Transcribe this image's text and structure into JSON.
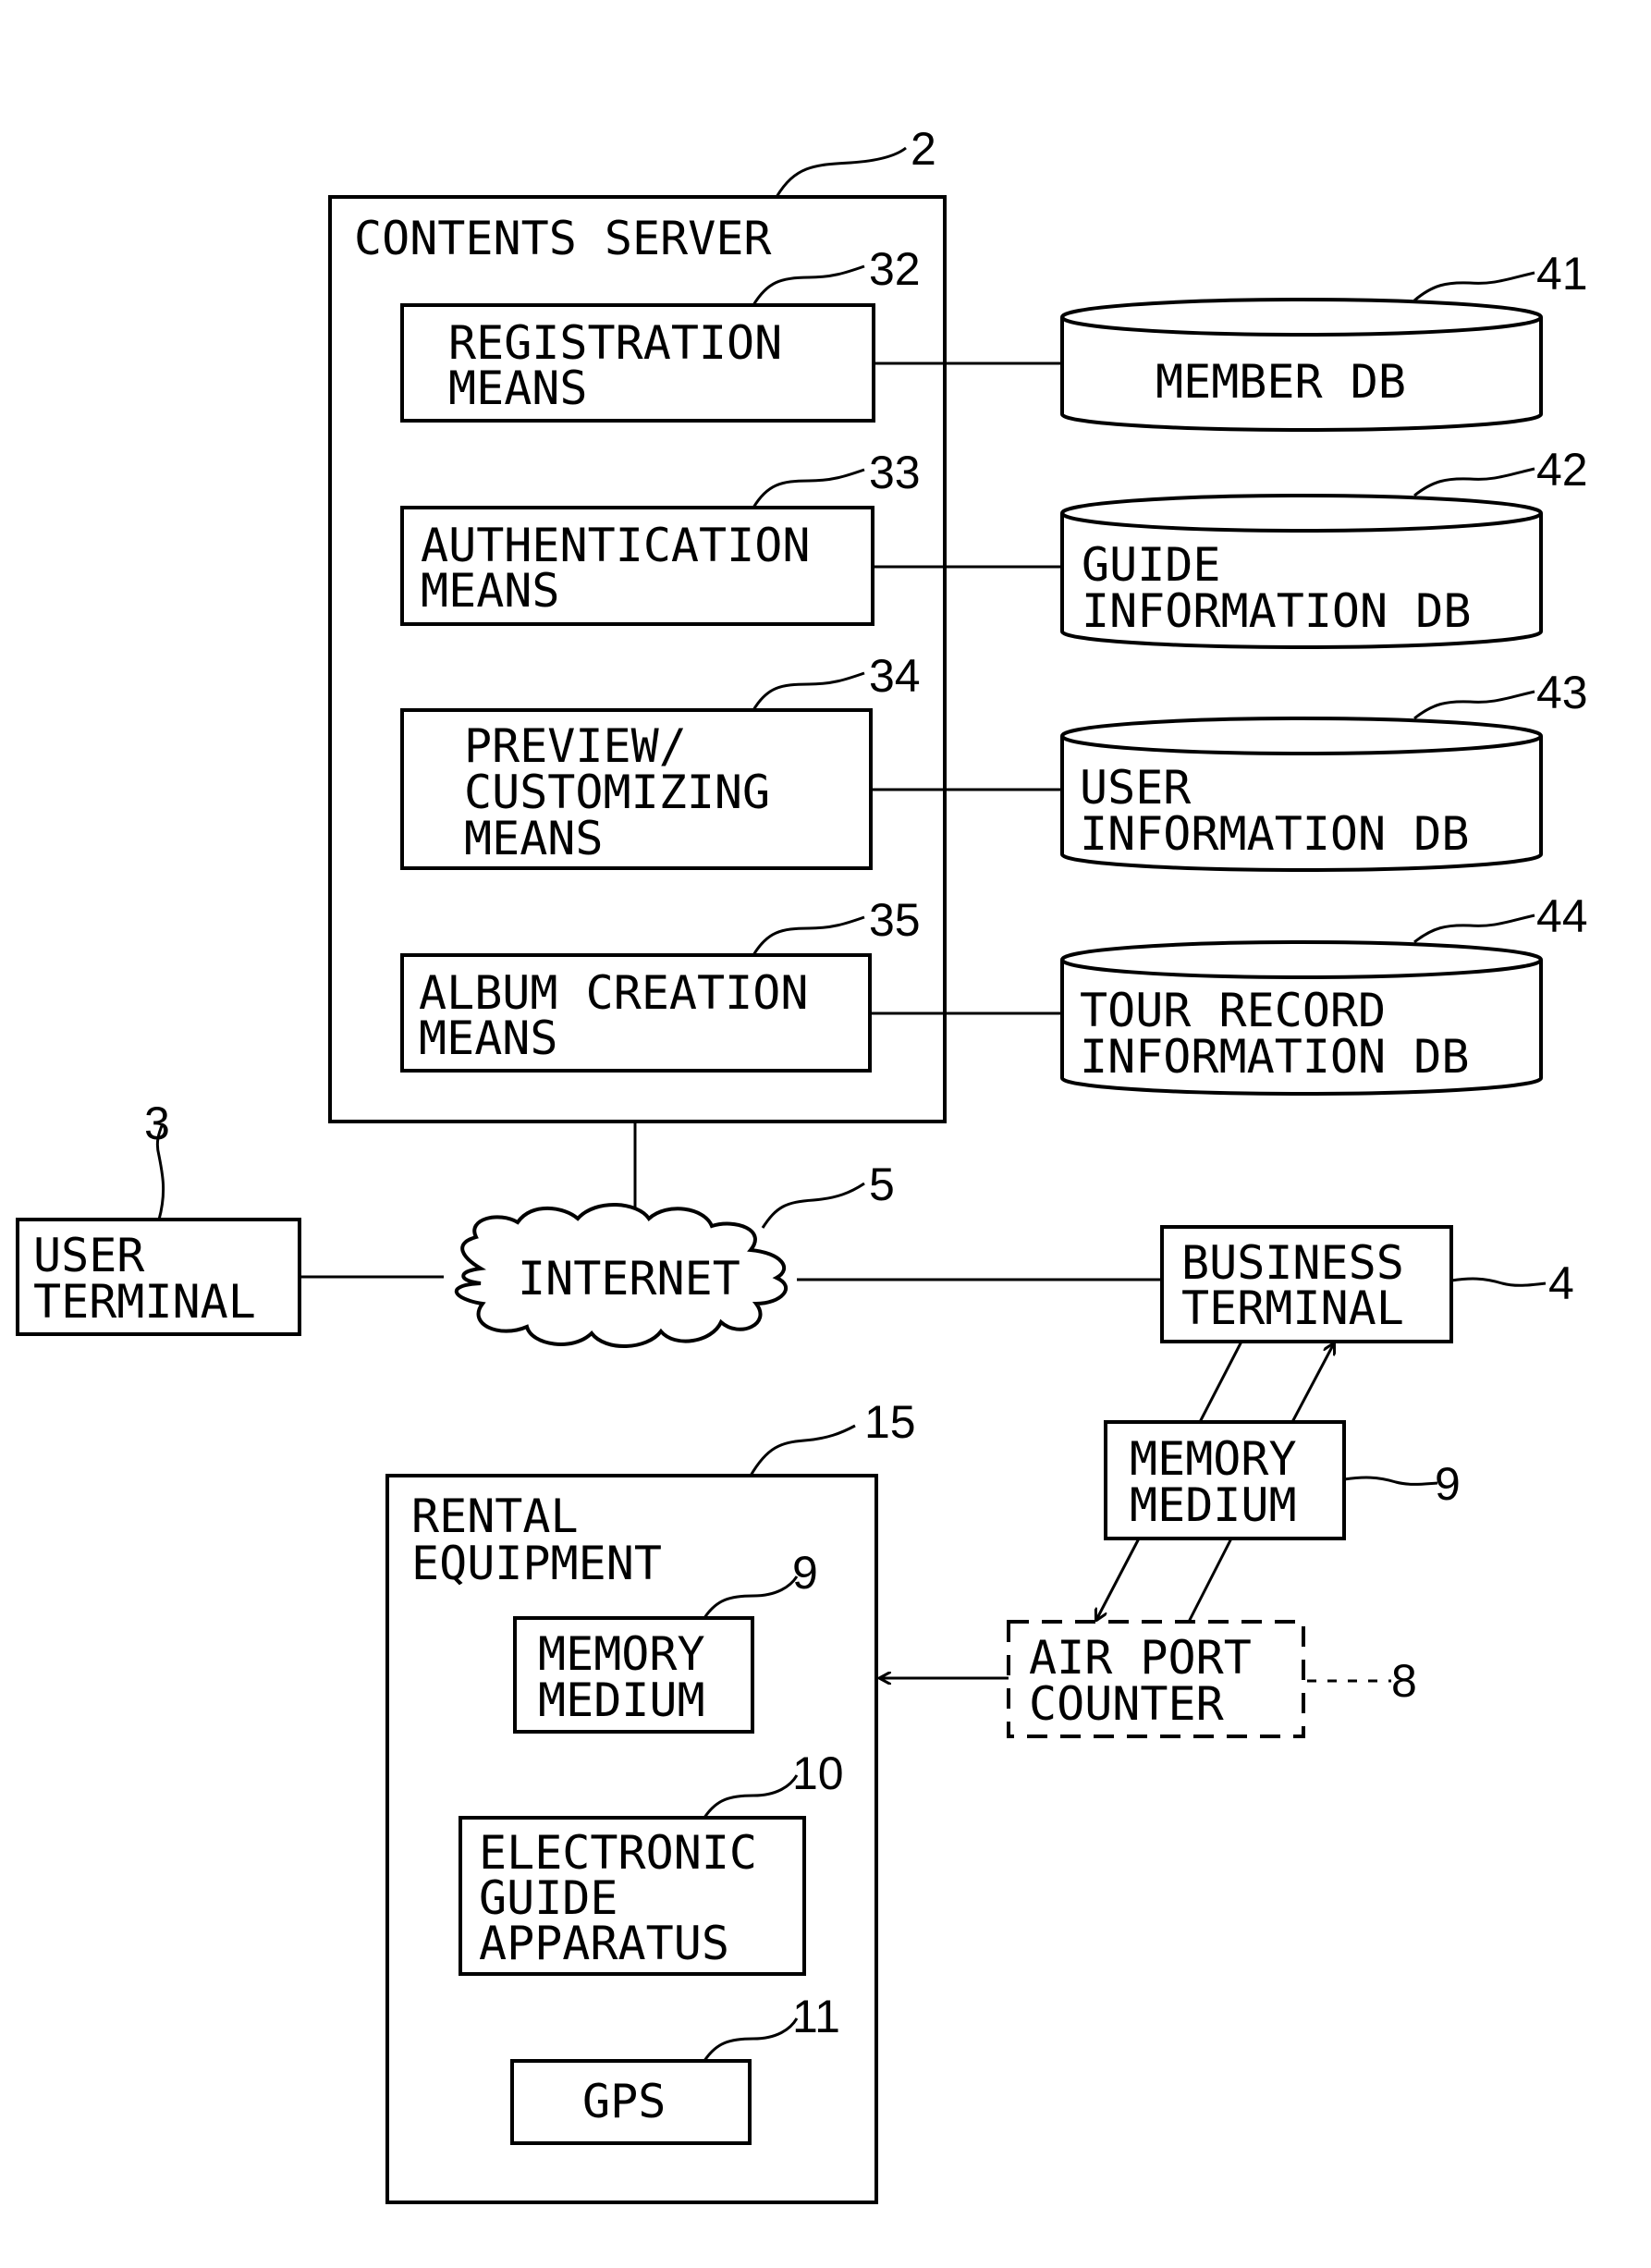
{
  "contents_server": {
    "ref": "2",
    "title": "CONTENTS SERVER",
    "modules": [
      {
        "ref": "32",
        "lines": [
          "REGISTRATION",
          "MEANS"
        ]
      },
      {
        "ref": "33",
        "lines": [
          "AUTHENTICATION",
          "MEANS"
        ]
      },
      {
        "ref": "34",
        "lines": [
          "PREVIEW/",
          "CUSTOMIZING",
          "MEANS"
        ]
      },
      {
        "ref": "35",
        "lines": [
          "ALBUM CREATION",
          "MEANS"
        ]
      }
    ]
  },
  "databases": [
    {
      "ref": "41",
      "lines": [
        "MEMBER DB"
      ]
    },
    {
      "ref": "42",
      "lines": [
        "GUIDE",
        "INFORMATION DB"
      ]
    },
    {
      "ref": "43",
      "lines": [
        "USER",
        "INFORMATION DB"
      ]
    },
    {
      "ref": "44",
      "lines": [
        "TOUR RECORD",
        "INFORMATION DB"
      ]
    }
  ],
  "user_terminal": {
    "ref": "3",
    "lines": [
      "USER",
      "TERMINAL"
    ]
  },
  "internet": {
    "ref": "5",
    "label": "INTERNET"
  },
  "business_terminal": {
    "ref": "4",
    "lines": [
      "BUSINESS",
      "TERMINAL"
    ]
  },
  "memory_medium_transfer": {
    "ref": "9",
    "lines": [
      "MEMORY",
      "MEDIUM"
    ]
  },
  "airport_counter": {
    "ref": "8",
    "lines": [
      "AIR PORT",
      "COUNTER"
    ]
  },
  "rental_equipment": {
    "ref": "15",
    "lines": [
      "RENTAL",
      "EQUIPMENT"
    ],
    "components": [
      {
        "ref": "9",
        "lines": [
          "MEMORY",
          "MEDIUM"
        ]
      },
      {
        "ref": "10",
        "lines": [
          "ELECTRONIC",
          "GUIDE",
          "APPARATUS"
        ]
      },
      {
        "ref": "11",
        "lines": [
          "GPS"
        ]
      }
    ]
  }
}
